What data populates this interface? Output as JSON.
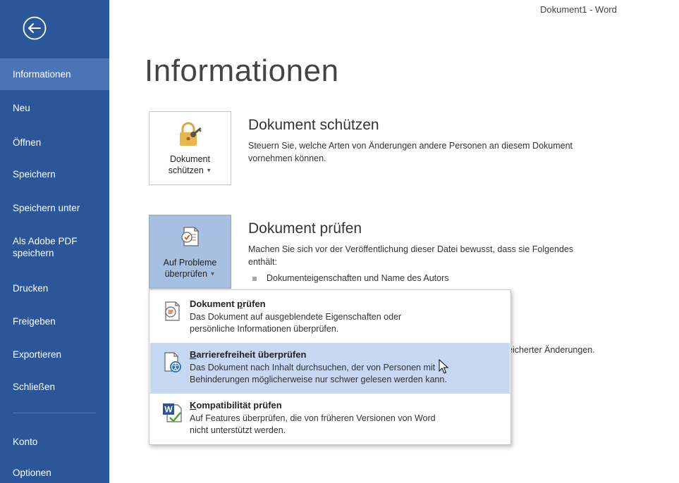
{
  "window": {
    "title": "Dokument1 - Word"
  },
  "sidebar": {
    "items": [
      {
        "label": "Informationen"
      },
      {
        "label": "Neu"
      },
      {
        "label": "Öffnen"
      },
      {
        "label": "Speichern"
      },
      {
        "label": "Speichern unter"
      },
      {
        "label": "Als Adobe PDF speichern"
      },
      {
        "label": "Drucken"
      },
      {
        "label": "Freigeben"
      },
      {
        "label": "Exportieren"
      },
      {
        "label": "Schließen"
      },
      {
        "label": "Konto"
      },
      {
        "label": "Optionen"
      }
    ],
    "active_color": "#4a74b5",
    "background": "#2b579a"
  },
  "main": {
    "title": "Informationen",
    "protect": {
      "button_line1": "Dokument",
      "button_line2": "schützen",
      "heading": "Dokument schützen",
      "desc_line1": "Steuern Sie, welche Arten von Änderungen andere Personen an diesem Dokument",
      "desc_line2": "vornehmen können."
    },
    "inspect": {
      "button_line1": "Auf Probleme",
      "button_line2": "überprüfen",
      "heading": "Dokument prüfen",
      "desc_line1": "Machen Sie sich vor der Veröffentlichung dieser Datei bewusst, dass sie Folgendes",
      "desc_line2": "enthält:",
      "bullet": "Dokumenteigenschaften und Name des Autors"
    },
    "partial_text": "eicherter Änderungen."
  },
  "menu": {
    "items": [
      {
        "title_pre": "Dokument ",
        "title_ul": "p",
        "title_post": "rüfen",
        "desc_line1": "Das Dokument auf ausgeblendete Eigenschaften oder",
        "desc_line2": "persönliche Informationen überprüfen."
      },
      {
        "title_pre": "",
        "title_ul": "B",
        "title_post": "arrierefreiheit überprüfen",
        "desc_line1": "Das Dokument nach Inhalt durchsuchen, der von Personen mit",
        "desc_line2": "Behinderungen möglicherweise nur schwer gelesen werden kann."
      },
      {
        "title_pre": "",
        "title_ul": "K",
        "title_post": "ompatibilität prüfen",
        "desc_line1": "Auf Features überprüfen, die von früheren Versionen von Word",
        "desc_line2": "nicht unterstützt werden."
      }
    ],
    "hover_color": "#c5d7f1"
  }
}
